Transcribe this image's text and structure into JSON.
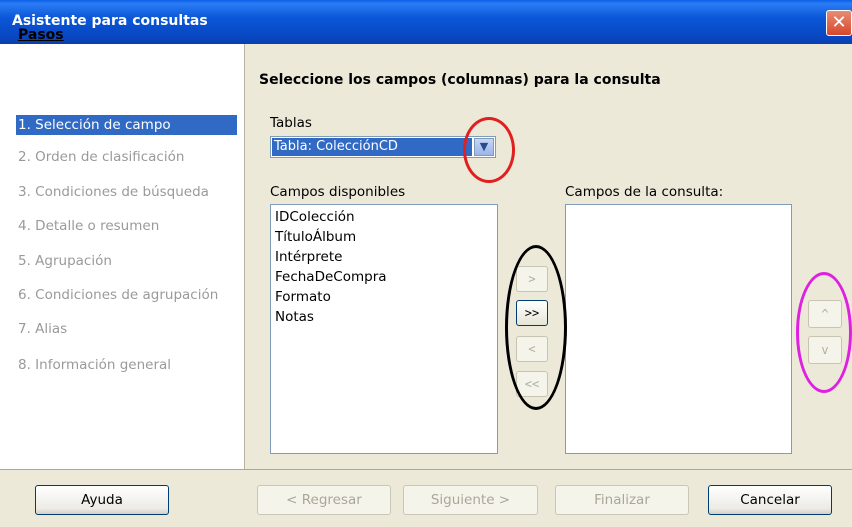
{
  "window": {
    "title": "Asistente para consultas",
    "close_glyph": "✕"
  },
  "steps": {
    "header": "Pasos",
    "items": [
      {
        "label": "1. Selección de campo",
        "active": true
      },
      {
        "label": "2. Orden de clasificación",
        "active": false
      },
      {
        "label": "3. Condiciones de búsqueda",
        "active": false
      },
      {
        "label": "4. Detalle o resumen",
        "active": false
      },
      {
        "label": "5. Agrupación",
        "active": false
      },
      {
        "label": "6. Condiciones de agrupación",
        "active": false
      },
      {
        "label": "7. Alias",
        "active": false
      },
      {
        "label": "8. Información general",
        "active": false
      }
    ]
  },
  "main": {
    "title": "Seleccione los campos (columnas) para la consulta",
    "tables_label": "Tablas",
    "tables_selected": "Tabla: ColecciónCD",
    "available_label": "Campos disponibles",
    "available_fields": [
      "IDColección",
      "TítuloÁlbum",
      "Intérprete",
      "FechaDeCompra",
      "Formato",
      "Notas"
    ],
    "query_label": "Campos de la consulta:",
    "query_fields": [],
    "move_buttons": {
      "add_one": ">",
      "add_all": ">>",
      "remove_one": "<",
      "remove_all": "<<"
    },
    "order_buttons": {
      "up": "^",
      "down": "v"
    }
  },
  "footer": {
    "help": "Ayuda",
    "back": "< Regresar",
    "next": "Siguiente >",
    "finish": "Finalizar",
    "cancel": "Cancelar"
  },
  "annotations": {
    "red": "#e02020",
    "black": "#000000",
    "magenta": "#e020e0"
  }
}
